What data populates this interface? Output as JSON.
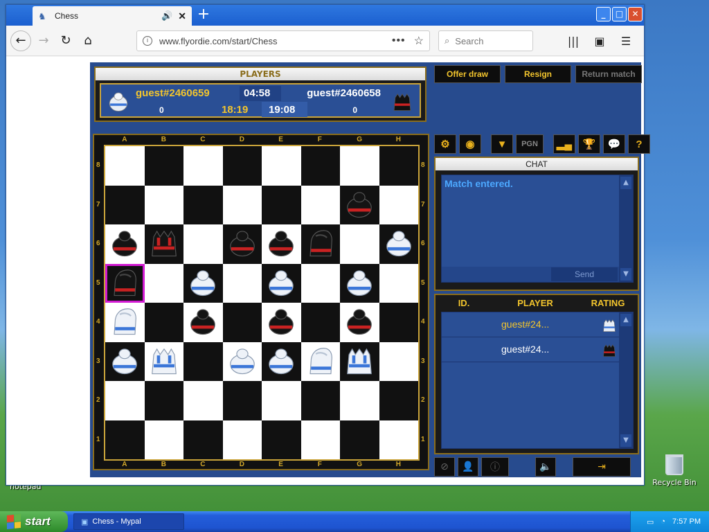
{
  "browser": {
    "tab_title": "Chess",
    "url": "www.flyordie.com/start/Chess",
    "search_placeholder": "Search",
    "url_actions_label": "•••"
  },
  "game": {
    "players_header": "PLAYERS",
    "player1": {
      "name": "guest#2460659",
      "move_time": "04:58",
      "total_time": "18:19",
      "score": "0",
      "color": "white"
    },
    "player2": {
      "name": "guest#2460658",
      "total_time": "19:08",
      "score": "0",
      "color": "black"
    },
    "buttons": {
      "offer_draw": "Offer draw",
      "resign": "Resign",
      "return_match": "Return match"
    },
    "toolbar": {
      "pgn": "PGN"
    },
    "chat": {
      "header": "CHAT",
      "message": "Match entered.",
      "send": "Send"
    },
    "player_list": {
      "columns": [
        "ID.",
        "PLAYER",
        "RATING"
      ],
      "rows": [
        {
          "name": "guest#24...",
          "color": "#f3c52d",
          "piece": "white"
        },
        {
          "name": "guest#24...",
          "color": "#ffffff",
          "piece": "black"
        }
      ]
    },
    "files": [
      "A",
      "B",
      "C",
      "D",
      "E",
      "F",
      "G",
      "H"
    ],
    "ranks": [
      "8",
      "7",
      "6",
      "5",
      "4",
      "3",
      "2",
      "1"
    ],
    "board": [
      [
        "",
        "",
        "",
        "",
        "",
        "",
        "",
        ""
      ],
      [
        "",
        "",
        "",
        "",
        "",
        "",
        "bP",
        ""
      ],
      [
        "bP",
        "bR",
        "",
        "bP",
        "bP",
        "bN",
        "",
        "wP"
      ],
      [
        "bN",
        "",
        "wP",
        "",
        "wP",
        "",
        "wP",
        ""
      ],
      [
        "wN",
        "",
        "bP",
        "",
        "bP",
        "",
        "bP",
        ""
      ],
      [
        "wP",
        "wR",
        "",
        "wP",
        "wP",
        "wN",
        "wR",
        ""
      ],
      [
        "",
        "",
        "",
        "",
        "",
        "",
        "",
        ""
      ],
      [
        "",
        "",
        "",
        "",
        "",
        "",
        "",
        ""
      ]
    ],
    "selected_square": "a5"
  },
  "desktop": {
    "recycle_bin": "Recycle Bin",
    "notepad_label": "notepad"
  },
  "taskbar": {
    "start": "start",
    "task": "Chess - Mypal",
    "clock": "7:57 PM"
  }
}
